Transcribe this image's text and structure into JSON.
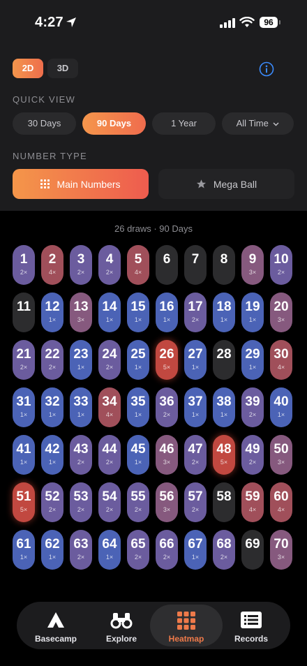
{
  "status_bar": {
    "time": "4:27",
    "battery": "96"
  },
  "dimension_toggle": {
    "options": [
      "2D",
      "3D"
    ],
    "selected": "2D"
  },
  "quick_view": {
    "label": "QUICK VIEW",
    "options": [
      "30 Days",
      "90 Days",
      "1 Year",
      "All Time"
    ],
    "selected": "90 Days"
  },
  "number_type": {
    "label": "NUMBER TYPE",
    "options": [
      "Main Numbers",
      "Mega Ball"
    ],
    "selected": "Main Numbers"
  },
  "summary": "26 draws · 90 Days",
  "heatmap": {
    "counts": [
      2,
      4,
      2,
      2,
      4,
      0,
      0,
      0,
      3,
      2,
      0,
      1,
      3,
      1,
      1,
      1,
      2,
      1,
      1,
      3,
      2,
      2,
      1,
      2,
      1,
      5,
      1,
      0,
      1,
      4,
      1,
      1,
      1,
      4,
      1,
      2,
      1,
      1,
      2,
      1,
      1,
      1,
      2,
      2,
      1,
      3,
      2,
      5,
      2,
      3,
      5,
      2,
      2,
      2,
      2,
      3,
      2,
      0,
      4,
      4,
      1,
      1,
      2,
      1,
      2,
      2,
      1,
      2,
      0,
      3
    ]
  },
  "tabs": [
    {
      "label": "Basecamp",
      "icon": "camp-icon"
    },
    {
      "label": "Explore",
      "icon": "binoculars-icon"
    },
    {
      "label": "Heatmap",
      "icon": "grid-icon"
    },
    {
      "label": "Records",
      "icon": "list-icon"
    }
  ],
  "active_tab": "Heatmap",
  "colors": {
    "accent": "#f07a4a",
    "heat_high": "#c14840",
    "heat_low": "#4b63b6",
    "heat_none": "#2c2c2e"
  }
}
